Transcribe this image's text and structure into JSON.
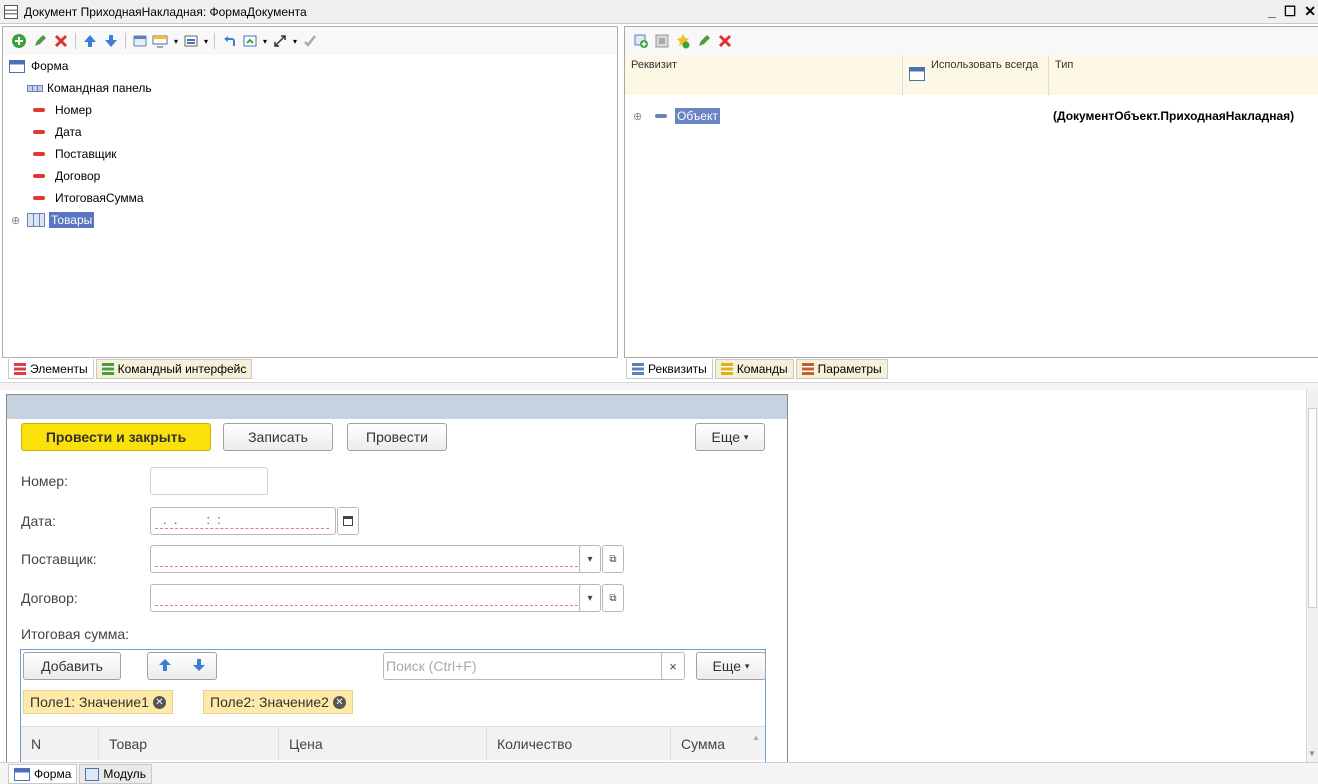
{
  "window": {
    "title": "Документ ПриходнаяНакладная: ФормаДокумента",
    "minimize": "_",
    "maximize": "☐",
    "close": "✕"
  },
  "elements_tree": {
    "root": "Форма",
    "items": [
      {
        "label": "Командная панель"
      },
      {
        "label": "Номер"
      },
      {
        "label": "Дата"
      },
      {
        "label": "Поставщик"
      },
      {
        "label": "Договор"
      },
      {
        "label": "ИтоговаяСумма"
      },
      {
        "label": "Товары"
      }
    ]
  },
  "left_tabs": [
    "Элементы",
    "Командный интерфейс"
  ],
  "attributes_panel": {
    "columns": {
      "attr": "Реквизит",
      "always": "Использовать всегда",
      "type": "Тип"
    },
    "rows": [
      {
        "name": "Объект",
        "type": "(ДокументОбъект.ПриходнаяНакладная)"
      }
    ]
  },
  "right_tabs": [
    "Реквизиты",
    "Команды",
    "Параметры"
  ],
  "form": {
    "buttons": {
      "post_close": "Провести и закрыть",
      "save": "Записать",
      "post": "Провести",
      "more": "Еще"
    },
    "fields": {
      "number_label": "Номер:",
      "date_label": "Дата:",
      "date_mask": ".  .        :  :",
      "supplier_label": "Поставщик:",
      "contract_label": "Договор:",
      "total_label": "Итоговая сумма:"
    },
    "table": {
      "add": "Добавить",
      "search_placeholder": "Поиск (Ctrl+F)",
      "clear": "×",
      "more": "Еще",
      "chips": [
        "Поле1: Значение1",
        "Поле2: Значение2"
      ],
      "columns": [
        "N",
        "Товар",
        "Цена",
        "Количество",
        "Сумма"
      ]
    }
  },
  "bottom_tabs": [
    "Форма",
    "Модуль"
  ]
}
